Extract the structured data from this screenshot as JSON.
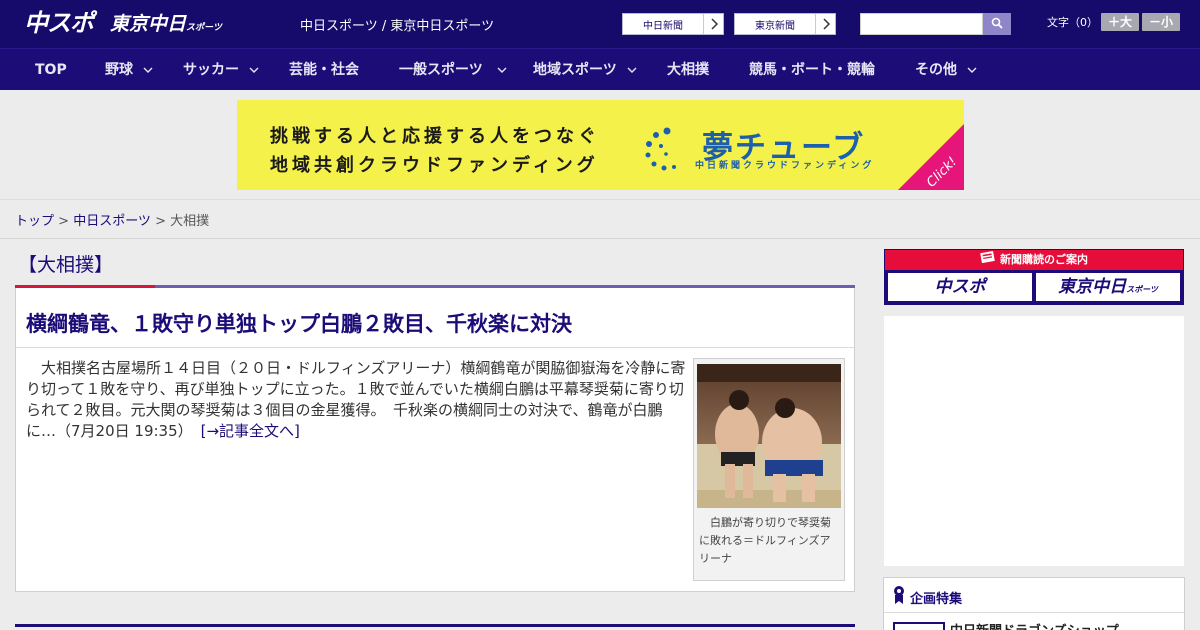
{
  "header": {
    "logo_chuspo": "中スポ",
    "logo_tokyo": "東京中日",
    "logo_tokyo_small": "スポーツ",
    "site_link_1": "中日スポーツ",
    "site_link_sep": " / ",
    "site_link_2": "東京中日スポーツ",
    "paper_btn_1": "中日新聞",
    "paper_btn_2": "東京新聞",
    "search_value": "",
    "font_label": "文字（0）",
    "font_larger": "＋大",
    "font_smaller": "－小",
    "icons": {
      "chevron": "chevron-right-icon",
      "search": "search-icon"
    }
  },
  "nav": {
    "items": [
      {
        "label": "TOP",
        "has_menu": false
      },
      {
        "label": "野球",
        "has_menu": true
      },
      {
        "label": "サッカー",
        "has_menu": true
      },
      {
        "label": "芸能・社会",
        "has_menu": false
      },
      {
        "label": "一般スポーツ",
        "has_menu": true
      },
      {
        "label": "地域スポーツ",
        "has_menu": true
      },
      {
        "label": "大相撲",
        "has_menu": false
      },
      {
        "label": "競馬・ボート・競輪",
        "has_menu": false
      },
      {
        "label": "その他",
        "has_menu": true
      }
    ]
  },
  "banner": {
    "line1": "挑戦する人と応援する人をつなぐ",
    "line2": "地域共創クラウドファンディング",
    "logo": "夢チューブ",
    "logo_sub": "中日新聞クラウドファンディング",
    "click": "Click!",
    "bg_color": "#f4f24a",
    "accent_color": "#e5157a"
  },
  "breadcrumb": {
    "home": "トップ",
    "section": "中日スポーツ",
    "current": "大相撲",
    "sep": " > "
  },
  "section": {
    "title": "【大相撲】"
  },
  "article": {
    "headline": "横綱鶴竜、１敗守り単独トップ白鵬２敗目、千秋楽に対決",
    "body": "大相撲名古屋場所１４日目（２０日・ドルフィンズアリーナ）横綱鶴竜が関脇御嶽海を冷静に寄り切って１敗を守り、再び単独トップに立った。１敗で並んでいた横綱白鵬は平幕琴奨菊に寄り切られて２敗目。元大関の琴奨菊は３個目の金星獲得。　千秋楽の横綱同士の対決で、鶴竜が白鵬に…（7月20日 19:35）",
    "read_more": "[→記事全文へ]",
    "photo_caption": "白鵬が寄り切りで琴奨菊に敗れる＝ドルフィンズアリーナ"
  },
  "sidebar": {
    "subscription_head": "新聞購読のご案内",
    "sub_btn_1": "中スポ",
    "sub_btn_2": "東京中日",
    "sub_btn_2_small": "スポーツ",
    "feature_title": "企画特集",
    "feature_item": "中日新聞ドラゴンズショップ"
  },
  "colors": {
    "brand_navy": "#160a6b",
    "nav_bg": "#1b0c78",
    "accent_red": "#d2193b",
    "accent_purple": "#6a5fb0"
  }
}
